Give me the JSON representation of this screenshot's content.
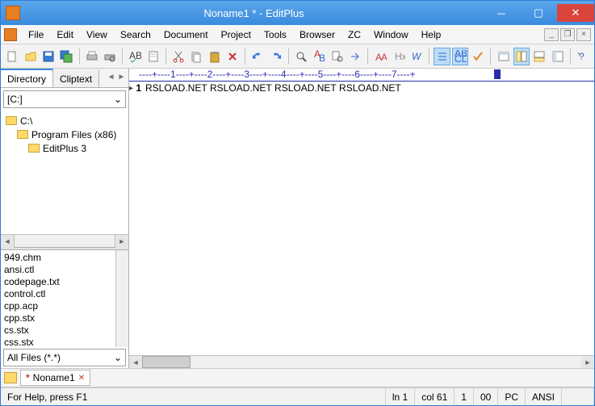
{
  "window": {
    "title": "Noname1 * - EditPlus"
  },
  "menu": {
    "items": [
      "File",
      "Edit",
      "View",
      "Search",
      "Document",
      "Project",
      "Tools",
      "Browser",
      "ZC",
      "Window",
      "Help"
    ]
  },
  "sidebar": {
    "tabs": {
      "active": "Directory",
      "inactive": "Cliptext"
    },
    "drive": "[C:]",
    "tree": {
      "root": "C:\\",
      "child1": "Program Files (x86)",
      "child2": "EditPlus 3"
    },
    "files": [
      "949.chm",
      "ansi.ctl",
      "codepage.txt",
      "control.ctl",
      "cpp.acp",
      "cpp.stx",
      "cs.stx",
      "css.stx"
    ],
    "filter": "All Files (*.*)"
  },
  "editor": {
    "ruler": "----+----1----+----2----+----3----+----4----+----5----+----6----+----7----+",
    "line_no": "1",
    "content": "RSLOAD.NET\tRSLOAD.NET\tRSLOAD.NET\tRSLOAD.NET"
  },
  "doctab": {
    "name": "Noname1",
    "modified": "*"
  },
  "status": {
    "help": "For Help, press F1",
    "ln": "ln 1",
    "col": "col 61",
    "sel": "1",
    "ovr": "00",
    "mode": "PC",
    "enc": "ANSI"
  }
}
